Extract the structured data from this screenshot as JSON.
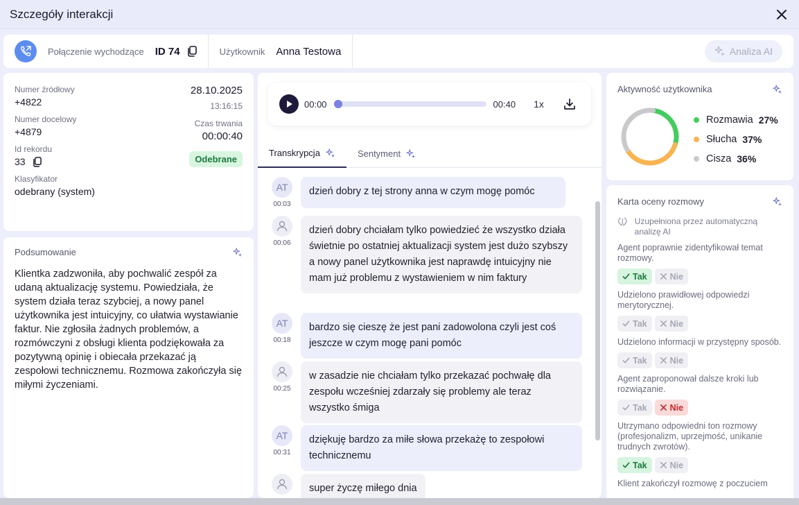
{
  "window": {
    "title": "Szczegóły interakcji"
  },
  "header": {
    "call_type": "Połączenie wychodzące",
    "id": "ID 74",
    "user_label": "Użytkownik",
    "user_name": "Anna Testowa",
    "ai_button": "Analiza AI"
  },
  "info": {
    "source_label": "Numer źródłowy",
    "source_value": "+4822",
    "target_label": "Numer docelowy",
    "target_value": "+4879",
    "record_label": "Id rekordu",
    "record_value": "33",
    "classifier_label": "Klasyfikator",
    "classifier_value": "odebrany (system)",
    "date": "28.10.2025",
    "time": "13:16:15",
    "duration_label": "Czas trwania",
    "duration": "00:00:40",
    "status": "Odebrane"
  },
  "summary": {
    "title": "Podsumowanie",
    "text": "Klientka zadzwoniła, aby pochwalić zespół za udaną aktualizację systemu. Powiedziała, że system działa teraz szybciej, a nowy panel użytkownika jest intuicyjny, co ułatwia wystawianie faktur. Nie zgłosiła żadnych problemów, a rozmówczyni z obsługi klienta podziękowała za pozytywną opinię i obiecała przekazać ją zespołowi technicznemu. Rozmowa zakończyła się miłymi życzeniami."
  },
  "player": {
    "current": "00:00",
    "total": "00:40",
    "speed": "1x",
    "progress": 0
  },
  "tabs": [
    "Transkrypcja",
    "Sentyment"
  ],
  "transcript": [
    {
      "who": "AT",
      "ts": "00:03",
      "text": "dzień dobry z tej strony anna w czym mogę pomóc"
    },
    {
      "who": "user",
      "ts": "00:06",
      "text": "dzień dobry chciałam tylko powiedzieć że wszystko działa świetnie po ostatniej aktualizacji system jest dużo szybszy a nowy panel użytkownika jest naprawdę intuicyjny nie mam już problemu z wystawieniem w nim faktury"
    },
    {
      "who": "AT",
      "ts": "00:18",
      "text": "bardzo się cieszę że jest pani zadowolona czyli jest coś jeszcze w czym mogę pani pomóc"
    },
    {
      "who": "user",
      "ts": "00:25",
      "text": "w zasadzie nie chciałam tylko przekazać pochwałę dla zespołu wcześniej zdarzały się problemy ale teraz wszystko śmiga"
    },
    {
      "who": "AT",
      "ts": "00:31",
      "text": "dziękuję bardzo za miłe słowa przekażę to zespołowi technicznemu"
    },
    {
      "who": "user",
      "ts": "",
      "text": "super życzę miłego dnia"
    }
  ],
  "activity": {
    "title": "Aktywność użytkownika",
    "items": [
      {
        "label": "Rozmawia",
        "pct": "27%",
        "value": 27,
        "color": "#44cc5e"
      },
      {
        "label": "Słucha",
        "pct": "37%",
        "value": 37,
        "color": "#f7b451"
      },
      {
        "label": "Cisza",
        "pct": "36%",
        "value": 36,
        "color": "#c9c9cc"
      }
    ]
  },
  "evaluation": {
    "title": "Karta oceny rozmowy",
    "note": "Uzupełniona przez automatyczną analizę AI",
    "yes": "Tak",
    "no": "Nie",
    "questions": [
      {
        "q": "Agent poprawnie zidentyfikował temat rozmowy.",
        "answer": "yes"
      },
      {
        "q": "Udzielono prawidłowej odpowiedzi merytorycznej.",
        "answer": "none"
      },
      {
        "q": "Udzielono informacji w przystępny sposób.",
        "answer": "none"
      },
      {
        "q": "Agent zaproponował dalsze kroki lub rozwiązanie.",
        "answer": "no"
      },
      {
        "q": "Utrzymano odpowiedni ton rozmowy (profesjonalizm, uprzejmość, unikanie trudnych zwrotów).",
        "answer": "yes"
      },
      {
        "q": "Klient zakończył rozmowę z poczuciem",
        "answer": "none"
      }
    ]
  }
}
